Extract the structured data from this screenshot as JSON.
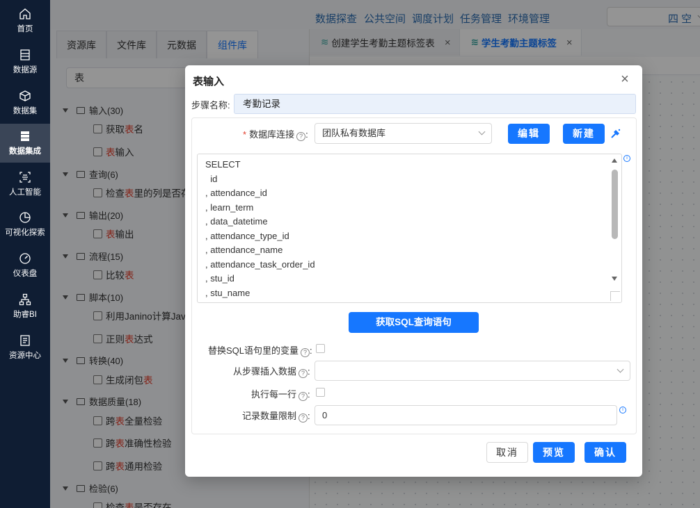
{
  "nav": {
    "items": [
      {
        "label": "首页",
        "icon": "home-icon"
      },
      {
        "label": "数据源",
        "icon": "datasource-icon"
      },
      {
        "label": "数据集",
        "icon": "dataset-icon"
      },
      {
        "label": "数据集成",
        "icon": "integration-icon",
        "active": true
      },
      {
        "label": "人工智能",
        "icon": "ai-icon"
      },
      {
        "label": "可视化探索",
        "icon": "visual-explore-icon"
      },
      {
        "label": "仪表盘",
        "icon": "dashboard-icon"
      },
      {
        "label": "助睿BI",
        "icon": "bi-icon"
      },
      {
        "label": "资源中心",
        "icon": "resource-center-icon"
      }
    ]
  },
  "topbar": {
    "links": [
      "数据探查",
      "公共空间",
      "调度计划",
      "任务管理",
      "环境管理"
    ],
    "partial_label": "四 空"
  },
  "left_panel": {
    "tabs": [
      "资源库",
      "文件库",
      "元数据",
      "组件库"
    ],
    "active_tab": "组件库",
    "search_value": "表",
    "tree": [
      {
        "category": "输入(30)",
        "items": [
          [
            "获取 ",
            "表",
            " 名"
          ],
          [
            "",
            "表",
            " 输入"
          ]
        ]
      },
      {
        "category": "查询(6)",
        "items": [
          [
            "检查 ",
            "表",
            " 里的列是否存"
          ]
        ]
      },
      {
        "category": "输出(20)",
        "items": [
          [
            "",
            "表",
            " 输出"
          ]
        ]
      },
      {
        "category": "流程(15)",
        "items": [
          [
            "比较 ",
            "表",
            ""
          ]
        ]
      },
      {
        "category": "脚本(10)",
        "items": [
          [
            "利用Janino计算Java",
            "",
            ""
          ],
          [
            "正则 ",
            "表",
            " 达式"
          ]
        ]
      },
      {
        "category": "转换(40)",
        "items": [
          [
            "生成闭包 ",
            "表",
            ""
          ]
        ]
      },
      {
        "category": "数据质量(18)",
        "items": [
          [
            "跨 ",
            "表",
            " 全量检验"
          ],
          [
            "跨 ",
            "表",
            " 准确性检验"
          ],
          [
            "跨 ",
            "表",
            " 通用检验"
          ]
        ]
      },
      {
        "category": "检验(6)",
        "items": [
          [
            "检查 ",
            "表",
            " 是否存在"
          ]
        ]
      }
    ]
  },
  "right_area": {
    "tabs": [
      {
        "label": "创建学生考勤主题标签表",
        "active": false
      },
      {
        "label": "学生考勤主题标签",
        "active": true
      }
    ]
  },
  "dialog": {
    "title": "表输入",
    "step_name_label": "步骤名称:",
    "step_name_value": "考勤记录",
    "db_conn_label": "数据库连接",
    "db_conn_value": "团队私有数据库",
    "edit_button": "编辑",
    "new_button": "新建",
    "sql_lines": [
      "SELECT",
      "  id",
      ", attendance_id",
      ", learn_term",
      ", data_datetime",
      ", attendance_type_id",
      ", attendance_name",
      ", attendance_task_order_id",
      ", stu_id",
      ", stu_name"
    ],
    "get_sql_button": "获取SQL查询语句",
    "replace_vars_label": "替换SQL语句里的变量",
    "insert_from_step_label": "从步骤插入数据",
    "insert_from_step_value": "",
    "exec_each_row_label": "执行每一行",
    "limit_label": "记录数量限制",
    "limit_value": "0",
    "cancel_button": "取消",
    "preview_button": "预览",
    "confirm_button": "确认"
  },
  "colors": {
    "nav_bg": "#0f1d33",
    "primary": "#1677ff",
    "highlight": "#e23c2a"
  }
}
